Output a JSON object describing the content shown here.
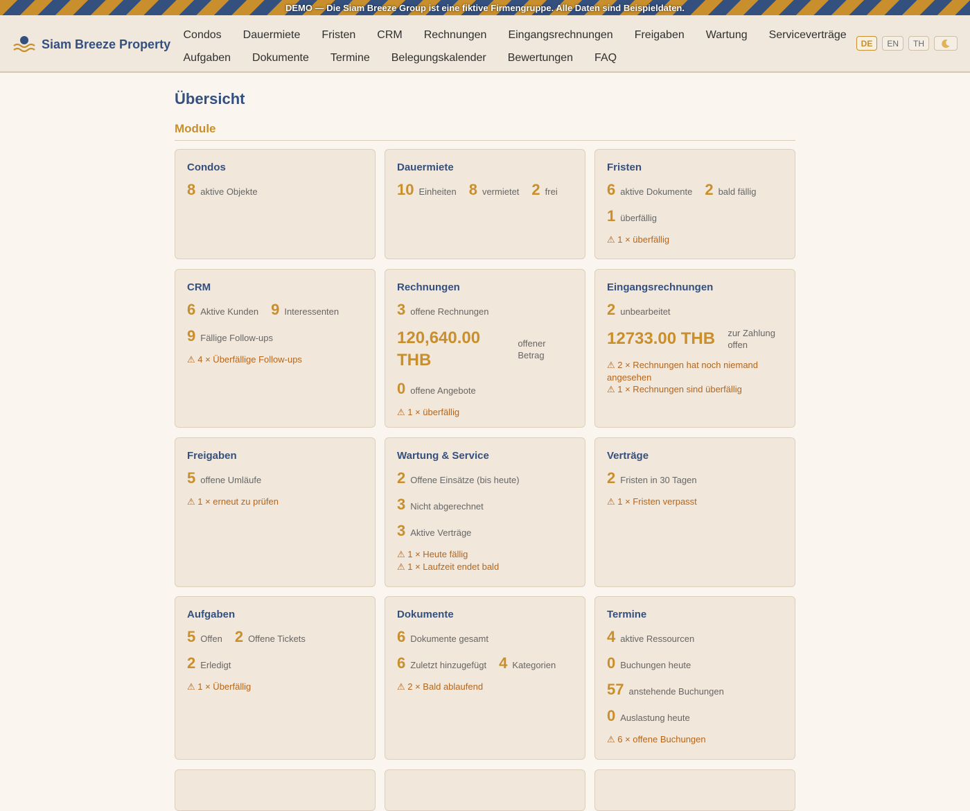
{
  "banner": "DEMO — Die Siam Breeze Group ist eine fiktive Firmengruppe. Alle Daten sind Beispieldaten.",
  "brand": {
    "name": "Siam Breeze Property"
  },
  "nav": {
    "row1": [
      "Condos",
      "Dauermiete",
      "Fristen",
      "CRM",
      "Rechnungen",
      "Eingangsrechnungen",
      "Freigaben",
      "Wartung",
      "Serviceverträge"
    ],
    "row2": [
      "Aufgaben",
      "Dokumente",
      "Termine",
      "Belegungskalender",
      "Bewertungen",
      "FAQ"
    ]
  },
  "lang": [
    "DE",
    "EN",
    "TH"
  ],
  "colors": {
    "primary": "#34507f",
    "accent": "#c98f2c",
    "warning": "#b4661c"
  },
  "page": {
    "title": "Übersicht",
    "section": "Module"
  },
  "cards": {
    "condos": {
      "title": "Condos",
      "s1n": "8",
      "s1l": "aktive Objekte"
    },
    "dauermiete": {
      "title": "Dauermiete",
      "s1n": "10",
      "s1l": "Einheiten",
      "s2n": "8",
      "s2l": "vermietet",
      "s3n": "2",
      "s3l": "frei"
    },
    "fristen": {
      "title": "Fristen",
      "s1n": "6",
      "s1l": "aktive Dokumente",
      "s2n": "2",
      "s2l": "bald fällig",
      "s3n": "1",
      "s3l": "überfällig",
      "w1": "⚠ 1 × überfällig"
    },
    "crm": {
      "title": "CRM",
      "s1n": "6",
      "s1l": "Aktive Kunden",
      "s2n": "9",
      "s2l": "Interessenten",
      "s3n": "9",
      "s3l": "Fällige Follow-ups",
      "w1": "⚠ 4 × Überfällige Follow-ups"
    },
    "rechnungen": {
      "title": "Rechnungen",
      "s1n": "3",
      "s1l": "offene Rechnungen",
      "amount": "120,640.00 THB",
      "amountLabel": "offener Betrag",
      "s2n": "0",
      "s2l": "offene Angebote",
      "w1": "⚠ 1 × überfällig"
    },
    "eingang": {
      "title": "Eingangsrechnungen",
      "s1n": "2",
      "s1l": "unbearbeitet",
      "amount": "12733.00 THB",
      "amountLabel": "zur Zahlung offen",
      "w1": "⚠ 2 × Rechnungen hat noch niemand angesehen",
      "w2": "⚠ 1 × Rechnungen sind überfällig"
    },
    "freigaben": {
      "title": "Freigaben",
      "s1n": "5",
      "s1l": "offene Umläufe",
      "w1": "⚠ 1 × erneut zu prüfen"
    },
    "wartung": {
      "title": "Wartung & Service",
      "s1n": "2",
      "s1l": "Offene Einsätze (bis heute)",
      "s2n": "3",
      "s2l": "Nicht abgerechnet",
      "s3n": "3",
      "s3l": "Aktive Verträge",
      "w1": "⚠ 1 × Heute fällig",
      "w2": "⚠ 1 × Laufzeit endet bald"
    },
    "vertraege": {
      "title": "Verträge",
      "s1n": "2",
      "s1l": "Fristen in 30 Tagen",
      "w1": "⚠ 1 × Fristen verpasst"
    },
    "aufgaben": {
      "title": "Aufgaben",
      "s1n": "5",
      "s1l": "Offen",
      "s2n": "2",
      "s2l": "Offene Tickets",
      "s3n": "2",
      "s3l": "Erledigt",
      "w1": "⚠ 1 × Überfällig"
    },
    "dokumente": {
      "title": "Dokumente",
      "s1n": "6",
      "s1l": "Dokumente gesamt",
      "s2n": "6",
      "s2l": "Zuletzt hinzugefügt",
      "s3n": "4",
      "s3l": "Kategorien",
      "w1": "⚠ 2 × Bald ablaufend"
    },
    "termine": {
      "title": "Termine",
      "s1n": "4",
      "s1l": "aktive Ressourcen",
      "s2n": "0",
      "s2l": "Buchungen heute",
      "s3n": "57",
      "s3l": "anstehende Buchungen",
      "s4n": "0",
      "s4l": "Auslastung heute",
      "w1": "⚠ 6 × offene Buchungen"
    }
  }
}
